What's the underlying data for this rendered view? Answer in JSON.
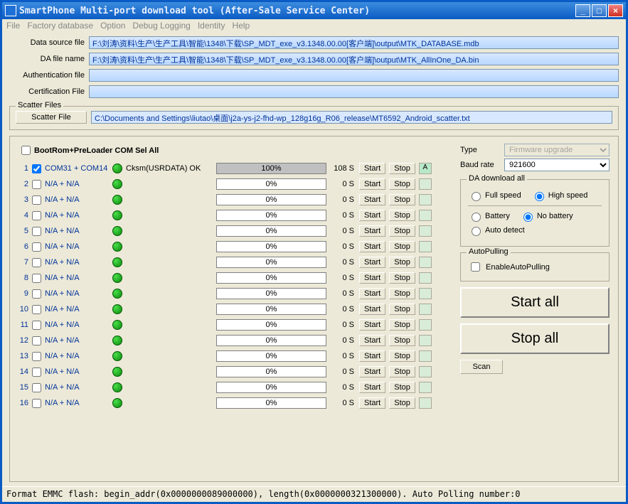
{
  "title": "SmartPhone Multi-port download tool (After-Sale Service Center)",
  "menu": [
    "File",
    "Factory database",
    "Option",
    "Debug Logging",
    "Identity",
    "Help"
  ],
  "files": {
    "datasource_label": "Data source file",
    "datasource": "F:\\刘涛\\资料\\生产\\生产工具\\智能\\1348\\下载\\SP_MDT_exe_v3.1348.00.00[客户端]\\output\\MTK_DATABASE.mdb",
    "dafile_label": "DA file name",
    "dafile": "F:\\刘涛\\资料\\生产\\生产工具\\智能\\1348\\下载\\SP_MDT_exe_v3.1348.00.00[客户端]\\output\\MTK_AllInOne_DA.bin",
    "auth_label": "Authentication file",
    "auth": "",
    "cert_label": "Certification File",
    "cert": ""
  },
  "scatter": {
    "legend": "Scatter Files",
    "button": "Scatter File",
    "path": "C:\\Documents and Settings\\liutao\\桌面\\j2a-ys-j2-fhd-wp_128g16g_R06_release\\MT6592_Android_scatter.txt"
  },
  "bootrom_label": "BootRom+PreLoader COM Sel All",
  "ports": [
    {
      "n": 1,
      "com": "COM31 + COM14",
      "checked": true,
      "status": "Cksm(USRDATA) OK",
      "pct": "100%",
      "filled": true,
      "time": "108 S",
      "flag": "A",
      "flagok": true
    },
    {
      "n": 2,
      "com": "N/A + N/A",
      "checked": false,
      "status": "",
      "pct": "0%",
      "filled": false,
      "time": "0 S",
      "flag": "",
      "flagok": false
    },
    {
      "n": 3,
      "com": "N/A + N/A",
      "checked": false,
      "status": "",
      "pct": "0%",
      "filled": false,
      "time": "0 S",
      "flag": "",
      "flagok": false
    },
    {
      "n": 4,
      "com": "N/A + N/A",
      "checked": false,
      "status": "",
      "pct": "0%",
      "filled": false,
      "time": "0 S",
      "flag": "",
      "flagok": false
    },
    {
      "n": 5,
      "com": "N/A + N/A",
      "checked": false,
      "status": "",
      "pct": "0%",
      "filled": false,
      "time": "0 S",
      "flag": "",
      "flagok": false
    },
    {
      "n": 6,
      "com": "N/A + N/A",
      "checked": false,
      "status": "",
      "pct": "0%",
      "filled": false,
      "time": "0 S",
      "flag": "",
      "flagok": false
    },
    {
      "n": 7,
      "com": "N/A + N/A",
      "checked": false,
      "status": "",
      "pct": "0%",
      "filled": false,
      "time": "0 S",
      "flag": "",
      "flagok": false
    },
    {
      "n": 8,
      "com": "N/A + N/A",
      "checked": false,
      "status": "",
      "pct": "0%",
      "filled": false,
      "time": "0 S",
      "flag": "",
      "flagok": false
    },
    {
      "n": 9,
      "com": "N/A + N/A",
      "checked": false,
      "status": "",
      "pct": "0%",
      "filled": false,
      "time": "0 S",
      "flag": "",
      "flagok": false
    },
    {
      "n": 10,
      "com": "N/A + N/A",
      "checked": false,
      "status": "",
      "pct": "0%",
      "filled": false,
      "time": "0 S",
      "flag": "",
      "flagok": false
    },
    {
      "n": 11,
      "com": "N/A + N/A",
      "checked": false,
      "status": "",
      "pct": "0%",
      "filled": false,
      "time": "0 S",
      "flag": "",
      "flagok": false
    },
    {
      "n": 12,
      "com": "N/A + N/A",
      "checked": false,
      "status": "",
      "pct": "0%",
      "filled": false,
      "time": "0 S",
      "flag": "",
      "flagok": false
    },
    {
      "n": 13,
      "com": "N/A + N/A",
      "checked": false,
      "status": "",
      "pct": "0%",
      "filled": false,
      "time": "0 S",
      "flag": "",
      "flagok": false
    },
    {
      "n": 14,
      "com": "N/A + N/A",
      "checked": false,
      "status": "",
      "pct": "0%",
      "filled": false,
      "time": "0 S",
      "flag": "",
      "flagok": false
    },
    {
      "n": 15,
      "com": "N/A + N/A",
      "checked": false,
      "status": "",
      "pct": "0%",
      "filled": false,
      "time": "0 S",
      "flag": "",
      "flagok": false
    },
    {
      "n": 16,
      "com": "N/A + N/A",
      "checked": false,
      "status": "",
      "pct": "0%",
      "filled": false,
      "time": "0 S",
      "flag": "",
      "flagok": false
    }
  ],
  "port_buttons": {
    "start": "Start",
    "stop": "Stop"
  },
  "type": {
    "label": "Type",
    "value": "Firmware upgrade"
  },
  "baud": {
    "label": "Baud rate",
    "value": "921600"
  },
  "da_group": {
    "legend": "DA download all",
    "full": "Full speed",
    "high": "High speed",
    "battery": "Battery",
    "nobattery": "No battery",
    "auto": "Auto detect"
  },
  "autopull": {
    "legend": "AutoPulling",
    "label": "EnableAutoPulling"
  },
  "actions": {
    "start_all": "Start all",
    "stop_all": "Stop all",
    "scan": "Scan"
  },
  "status_text": "Format EMMC flash:  begin_addr(0x0000000089000000), length(0x0000000321300000). Auto Polling number:0"
}
